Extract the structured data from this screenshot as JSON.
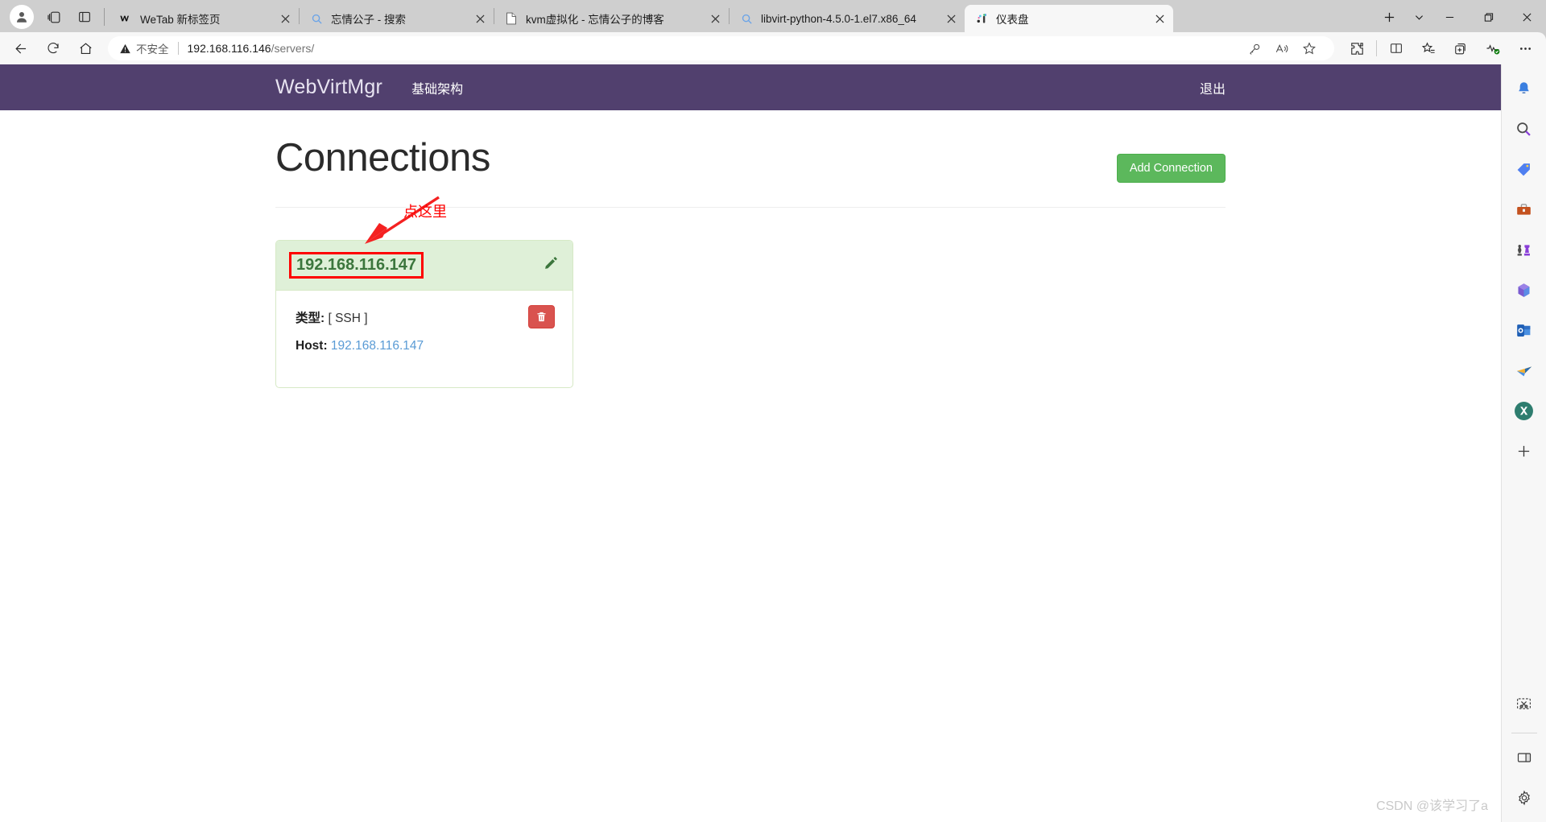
{
  "browser": {
    "toolbar_left": [
      {
        "name": "profile-avatar",
        "icon": "person-icon"
      },
      {
        "name": "workspaces-button",
        "icon": "copilot-workspaces-icon"
      },
      {
        "name": "tab-actions-button",
        "icon": "split-panel-icon"
      }
    ],
    "tabs": [
      {
        "title": "WeTab 新标签页",
        "favicon": "wetab-icon",
        "active": false
      },
      {
        "title": "忘情公子 - 搜索",
        "favicon": "search-icon",
        "active": false
      },
      {
        "title": "kvm虚拟化 - 忘情公子的博客",
        "favicon": "document-icon",
        "active": false
      },
      {
        "title": "libvirt-python-4.5.0-1.el7.x86_64",
        "favicon": "search-icon",
        "active": false
      },
      {
        "title": "仪表盘",
        "favicon": "dashboard-icon",
        "active": true
      }
    ],
    "tab_controls": {
      "new_tab": "+",
      "tab_list_dropdown": "⌄"
    },
    "window_controls": {
      "minimize": "—",
      "maximize": "❐",
      "close": "✕"
    },
    "nav": {
      "back": "back-icon",
      "refresh": "refresh-icon",
      "home": "home-icon"
    },
    "omnibox": {
      "security_label": "不安全",
      "url_host": "192.168.116.146",
      "url_path": "/servers/",
      "actions": [
        "password-key-icon",
        "read-aloud-icon",
        "favorite-star-icon"
      ]
    },
    "toolbar_right": [
      {
        "name": "extensions-icon",
        "label": "扩展"
      },
      {
        "name": "split-screen-icon",
        "label": "拆分屏幕"
      },
      {
        "name": "favorites-icon",
        "label": "收藏夹"
      },
      {
        "name": "collections-icon",
        "label": "集锦"
      },
      {
        "name": "browser-essentials-icon",
        "label": "浏览器基本功能"
      },
      {
        "name": "settings-more-icon",
        "label": "设置及其他"
      }
    ],
    "edgebar": [
      {
        "name": "notifications-bell-icon",
        "label": "通知"
      },
      {
        "name": "search-icon",
        "label": "搜索"
      },
      {
        "name": "shopping-tag-icon",
        "label": "购物"
      },
      {
        "name": "tools-toolbox-icon",
        "label": "工具"
      },
      {
        "name": "games-chess-icon",
        "label": "游戏"
      },
      {
        "name": "microsoft-365-icon",
        "label": "Microsoft 365"
      },
      {
        "name": "outlook-icon",
        "label": "Outlook"
      },
      {
        "name": "paper-plane-icon",
        "label": "发送"
      },
      {
        "name": "x-app-icon",
        "label": "X"
      },
      {
        "name": "add-sidebar-icon",
        "label": "+"
      },
      {
        "name": "web-capture-icon",
        "label": "网页捕获"
      },
      {
        "name": "toggle-sidebar-icon",
        "label": "切换边栏"
      },
      {
        "name": "sidebar-settings-icon",
        "label": "边栏设置"
      }
    ]
  },
  "app": {
    "brand": "WebVirtMgr",
    "nav_link": "基础架构",
    "logout": "退出",
    "page_title": "Connections",
    "add_button": "Add Connection",
    "connection": {
      "name": "192.168.116.147",
      "edit_icon": "pencil-edit-icon",
      "delete_icon": "trash-delete-icon",
      "type_label": "类型:",
      "type_value": "[ SSH ]",
      "host_label": "Host:",
      "host_value": "192.168.116.147"
    },
    "annotation": {
      "text": "点这里",
      "color": "#ff0000"
    },
    "watermark": "CSDN @该学习了a",
    "colors": {
      "navbar": "#51406e",
      "add_button": "#5cb85c",
      "card_header": "#dff0d8",
      "card_border": "#d6e9c6",
      "card_name_text": "#3c763d",
      "delete_button": "#d9534f",
      "host_link": "#5a9bd5",
      "annotation": "#ff0000"
    }
  }
}
